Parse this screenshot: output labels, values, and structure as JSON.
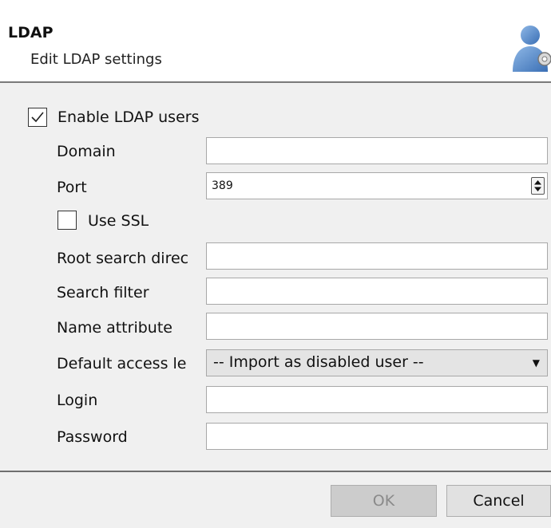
{
  "header": {
    "title": "LDAP",
    "subtitle": "Edit LDAP settings",
    "icon": "user-settings-icon"
  },
  "form": {
    "enable": {
      "label": "Enable LDAP users",
      "checked": true
    },
    "domain": {
      "label": "Domain",
      "value": ""
    },
    "port": {
      "label": "Port",
      "value": "389"
    },
    "ssl": {
      "label": "Use SSL",
      "checked": false
    },
    "root_search": {
      "label": "Root search direc",
      "value": ""
    },
    "search_filter": {
      "label": "Search filter",
      "value": ""
    },
    "name_attribute": {
      "label": "Name attribute",
      "value": ""
    },
    "default_access": {
      "label": "Default access le",
      "value": "-- Import as disabled user --"
    },
    "login": {
      "label": "Login",
      "value": ""
    },
    "password": {
      "label": "Password",
      "value": ""
    }
  },
  "buttons": {
    "ok": "OK",
    "cancel": "Cancel"
  },
  "colors": {
    "header_bg": "#ffffff",
    "body_bg": "#f0f0f0",
    "disabled_button_bg": "#cccccc",
    "icon_blue": "#4a7fc1"
  }
}
